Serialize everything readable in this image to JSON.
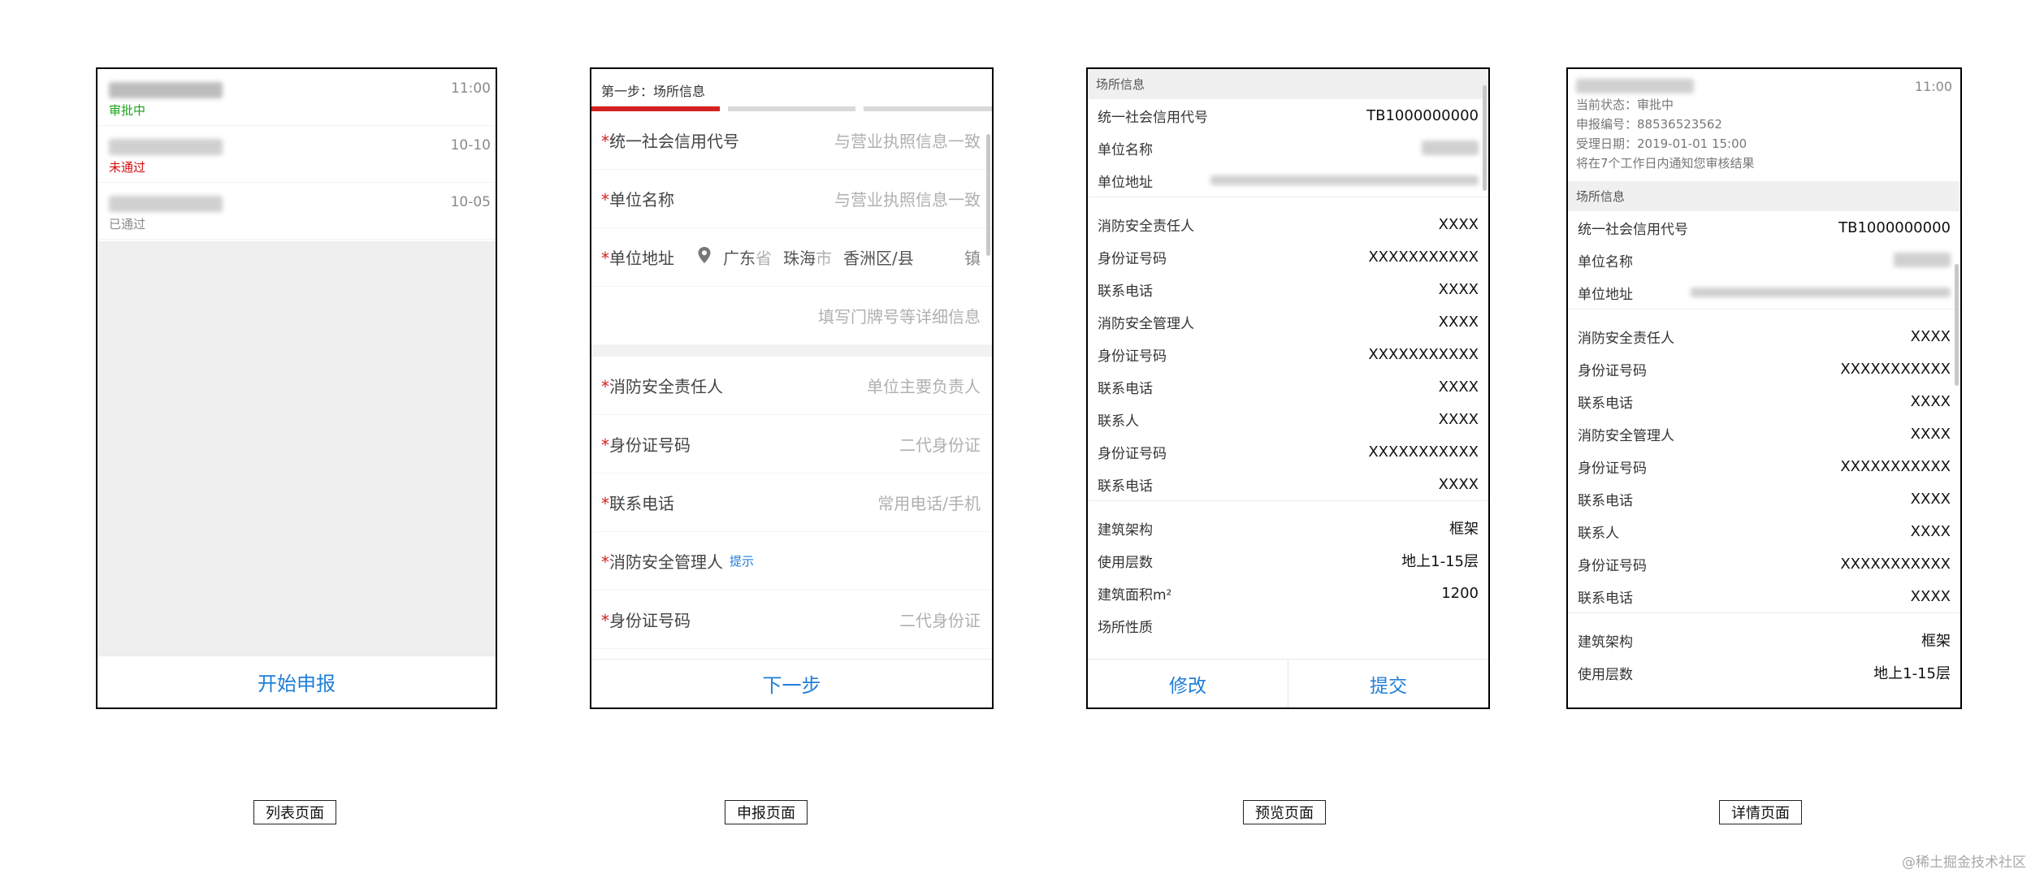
{
  "list_page": {
    "items": [
      {
        "time": "11:00",
        "status": "审批中"
      },
      {
        "time": "10-10",
        "status": "未通过"
      },
      {
        "time": "10-05",
        "status": "已通过"
      }
    ],
    "button": "开始申报"
  },
  "apply_page": {
    "step_title": "第一步：场所信息",
    "fields": [
      {
        "label": "统一社会信用代号",
        "placeholder": "与营业执照信息一致"
      },
      {
        "label": "单位名称",
        "placeholder": "与营业执照信息一致"
      },
      {
        "label": "消防安全责任人",
        "placeholder": "单位主要负责人"
      },
      {
        "label": "身份证号码",
        "placeholder": "二代身份证"
      },
      {
        "label": "联系电话",
        "placeholder": "常用电话/手机"
      },
      {
        "label": "消防安全管理人",
        "hint": "提示"
      },
      {
        "label": "身份证号码",
        "placeholder": "二代身份证"
      }
    ],
    "address": {
      "label": "单位地址",
      "province": "广东",
      "province_suffix": "省",
      "city": "珠海",
      "city_suffix": "市",
      "district": "香洲区/县",
      "town": "镇",
      "detail_placeholder": "填写门牌号等详细信息"
    },
    "required_mark": "*",
    "button": "下一步"
  },
  "preview_page": {
    "section_title": "场所信息",
    "rows_group1": [
      {
        "k": "统一社会信用代号",
        "v": "TB1000000000"
      },
      {
        "k": "单位名称"
      },
      {
        "k": "单位地址"
      }
    ],
    "rows_group2": [
      {
        "k": "消防安全责任人",
        "v": "XXXX"
      },
      {
        "k": "身份证号码",
        "v": "XXXXXXXXXXX"
      },
      {
        "k": "联系电话",
        "v": "XXXX"
      },
      {
        "k": "消防安全管理人",
        "v": "XXXX"
      },
      {
        "k": "身份证号码",
        "v": "XXXXXXXXXXX"
      },
      {
        "k": "联系电话",
        "v": "XXXX"
      },
      {
        "k": "联系人",
        "v": "XXXX"
      },
      {
        "k": "身份证号码",
        "v": "XXXXXXXXXXX"
      },
      {
        "k": "联系电话",
        "v": "XXXX"
      }
    ],
    "rows_group3": [
      {
        "k": "建筑架构",
        "v": "框架"
      },
      {
        "k": "使用层数",
        "v": "地上1-15层"
      },
      {
        "k": "建筑面积m²",
        "v": "1200"
      },
      {
        "k": "场所性质",
        "v": ""
      }
    ],
    "btn_edit": "修改",
    "btn_submit": "提交"
  },
  "detail_page": {
    "time": "11:00",
    "status_line": "当前状态：审批中",
    "number_line": "申报编号：88536523562",
    "date_line": "受理日期：2019-01-01 15:00",
    "notice_line": "将在7个工作日内通知您审核结果",
    "section_title": "场所信息",
    "rows_group1": [
      {
        "k": "统一社会信用代号",
        "v": "TB1000000000"
      },
      {
        "k": "单位名称"
      },
      {
        "k": "单位地址"
      }
    ],
    "rows_group2": [
      {
        "k": "消防安全责任人",
        "v": "XXXX"
      },
      {
        "k": "身份证号码",
        "v": "XXXXXXXXXXX"
      },
      {
        "k": "联系电话",
        "v": "XXXX"
      },
      {
        "k": "消防安全管理人",
        "v": "XXXX"
      },
      {
        "k": "身份证号码",
        "v": "XXXXXXXXXXX"
      },
      {
        "k": "联系电话",
        "v": "XXXX"
      },
      {
        "k": "联系人",
        "v": "XXXX"
      },
      {
        "k": "身份证号码",
        "v": "XXXXXXXXXXX"
      },
      {
        "k": "联系电话",
        "v": "XXXX"
      }
    ],
    "rows_group3": [
      {
        "k": "建筑架构",
        "v": "框架"
      },
      {
        "k": "使用层数",
        "v": "地上1-15层"
      }
    ]
  },
  "captions": {
    "list": "列表页面",
    "apply": "申报页面",
    "preview": "预览页面",
    "detail": "详情页面"
  },
  "watermark": "@稀土掘金技术社区",
  "colors": {
    "accent_blue": "#1f7fd8",
    "progress_red": "#d42020",
    "status_green": "#1aa51a",
    "status_red": "#d40f0f"
  }
}
